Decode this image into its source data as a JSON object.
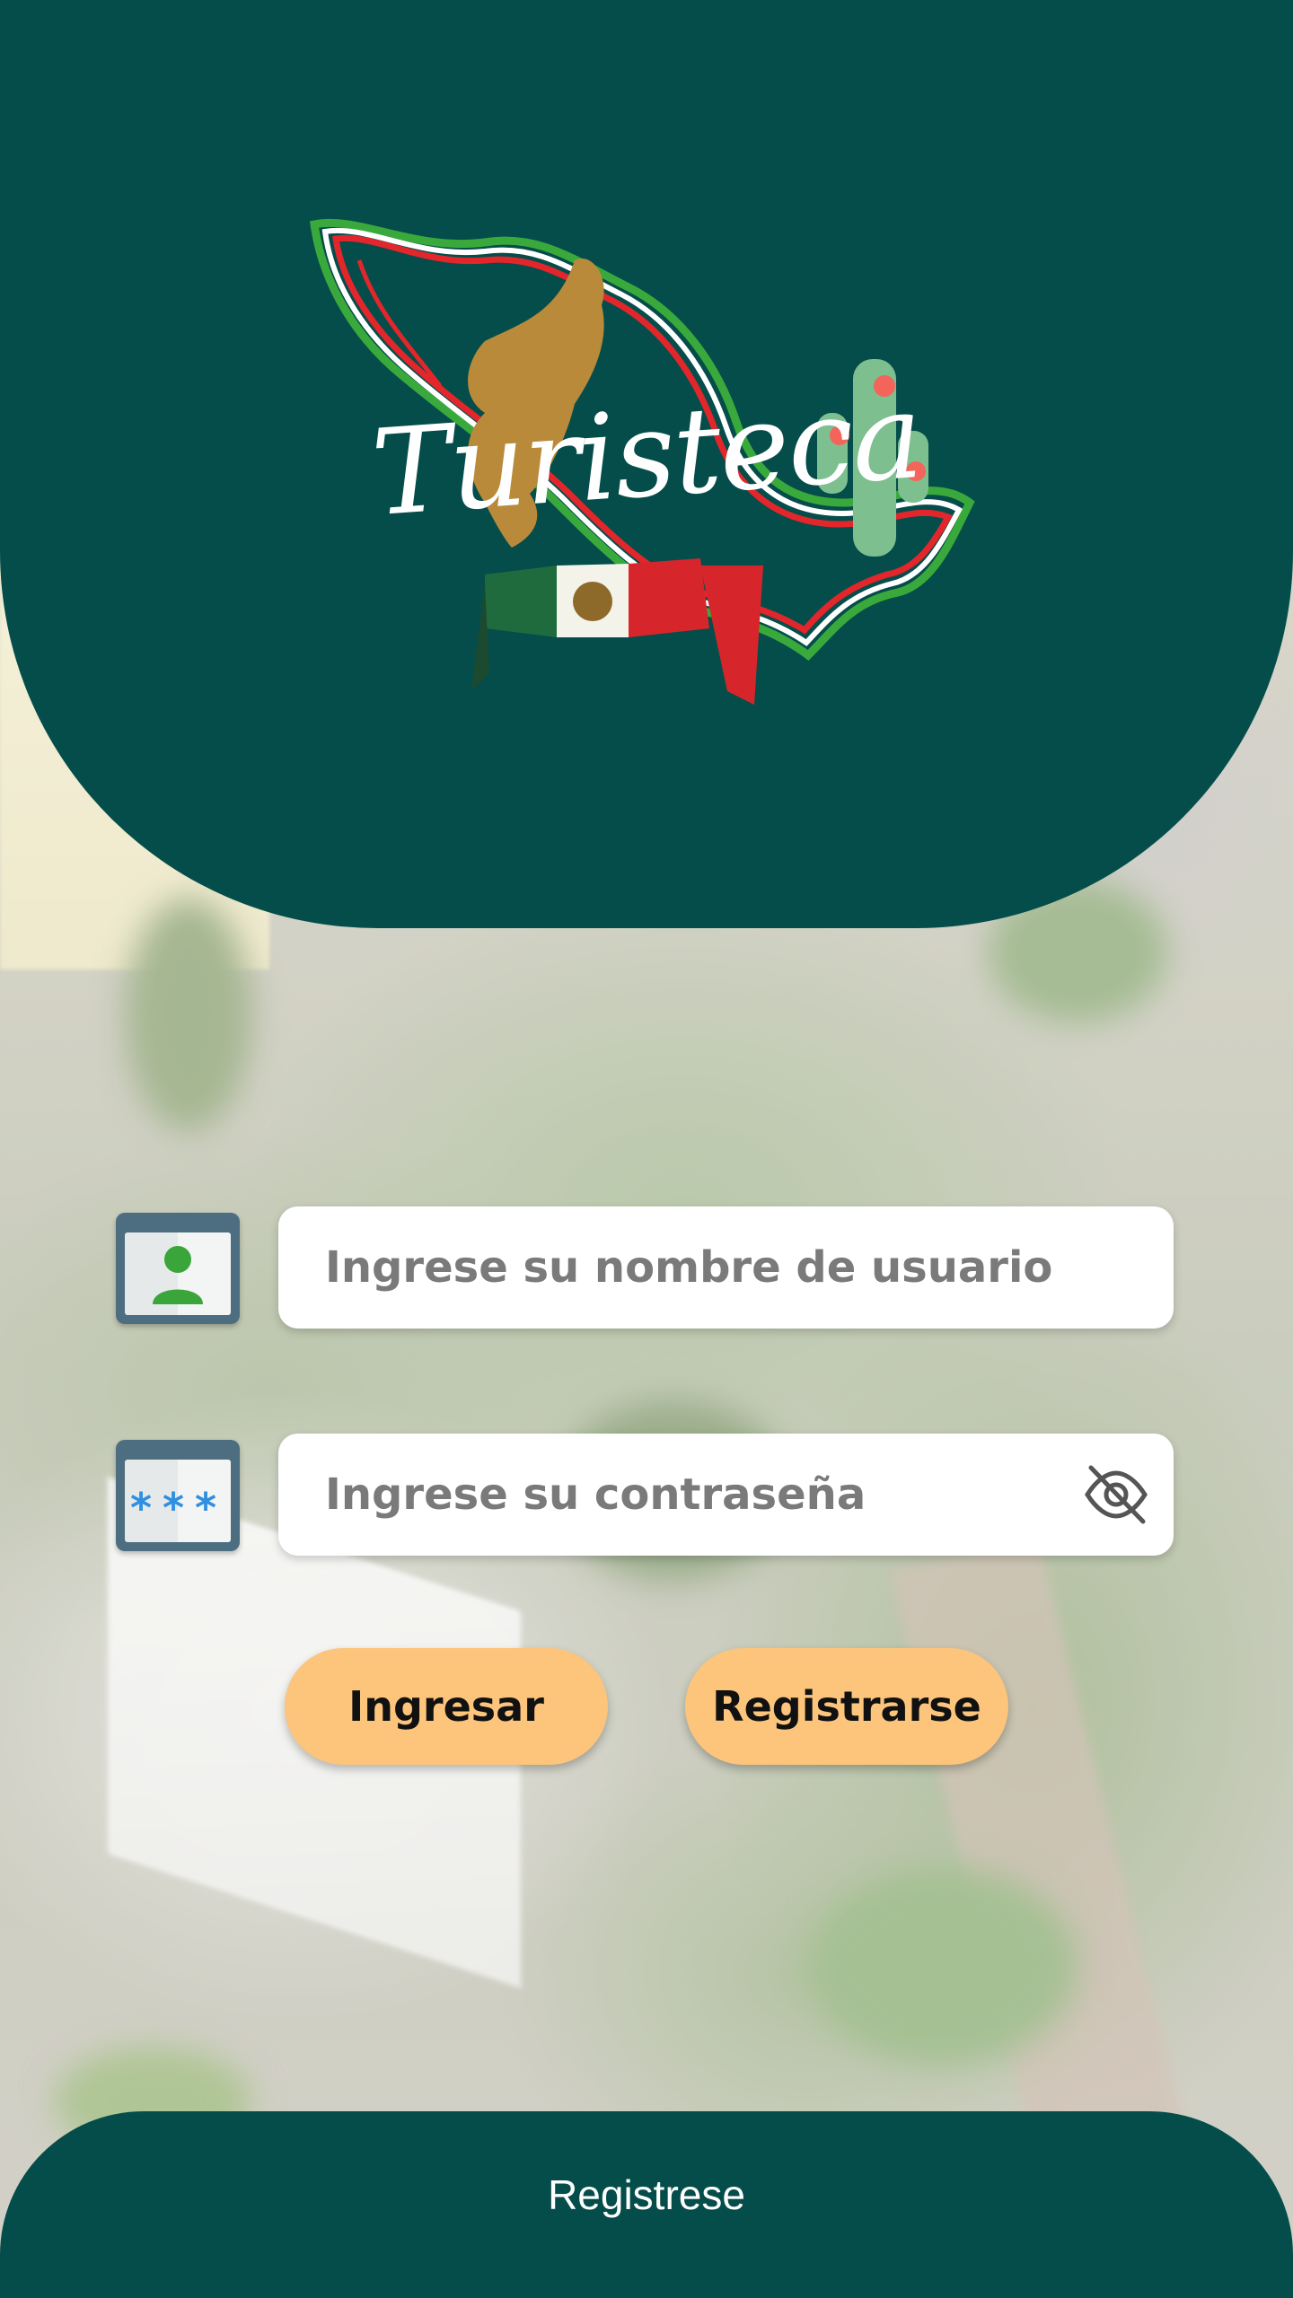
{
  "header": {
    "logo_text": "Turisteca"
  },
  "login": {
    "username_placeholder": "Ingrese su nombre de usuario",
    "username_value": "",
    "password_placeholder": "Ingrese su contraseña",
    "password_value": "",
    "password_toggle_icon": "eye-off-icon"
  },
  "icons": {
    "user": "user-card-icon",
    "password": "password-asterisks-icon"
  },
  "buttons": {
    "login_label": "Ingresar",
    "register_label": "Registrarse"
  },
  "footer": {
    "link_label": "Registrese"
  },
  "colors": {
    "primary": "#054d4a",
    "button": "#fcc57b",
    "field": "#ffffff"
  }
}
